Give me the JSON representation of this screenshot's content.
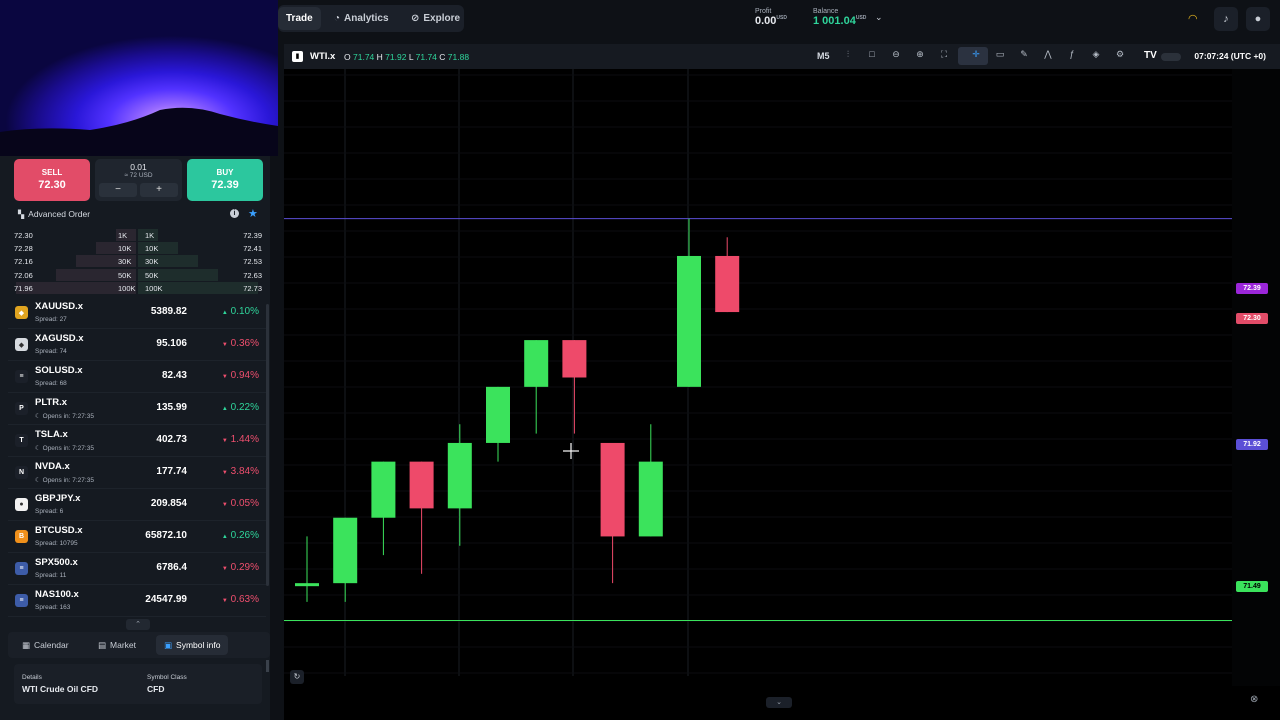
{
  "nav": {
    "trade": "Trade",
    "analytics": "Analytics",
    "explore": "Explore"
  },
  "account": {
    "profit_label": "Profit",
    "profit_value": "0.00",
    "profit_currency": "USD",
    "balance_label": "Balance",
    "balance_value": "1 001.04",
    "balance_currency": "USD"
  },
  "order": {
    "sell_label": "SELL",
    "sell_price": "72.30",
    "buy_label": "BUY",
    "buy_price": "72.39",
    "quantity": "0.01",
    "quantity_usd": "≈ 72 USD",
    "minus": "−",
    "plus": "+",
    "advanced_label": "Advanced Order"
  },
  "depth": [
    {
      "bid": "72.30",
      "bid_size": "1K",
      "ask_size": "1K",
      "ask": "72.39"
    },
    {
      "bid": "72.28",
      "bid_size": "10K",
      "ask_size": "10K",
      "ask": "72.41"
    },
    {
      "bid": "72.16",
      "bid_size": "30K",
      "ask_size": "30K",
      "ask": "72.53"
    },
    {
      "bid": "72.06",
      "bid_size": "50K",
      "ask_size": "50K",
      "ask": "72.63"
    },
    {
      "bid": "71.96",
      "bid_size": "100K",
      "ask_size": "100K",
      "ask": "72.73"
    }
  ],
  "watchlist": [
    {
      "name": "XAUUSD.x",
      "sub": "Spread: 27",
      "price": "5389.82",
      "change": "0.10%",
      "dir": "up",
      "icon": "gold-icon",
      "icon_char": "◆",
      "icon_bg": "#e0a420"
    },
    {
      "name": "XAGUSD.x",
      "sub": "Spread: 74",
      "price": "95.106",
      "change": "0.36%",
      "dir": "dn",
      "icon": "silver-icon",
      "icon_char": "◆",
      "icon_bg": "#d7dbe0"
    },
    {
      "name": "SOLUSD.x",
      "sub": "Spread: 68",
      "price": "82.43",
      "change": "0.94%",
      "dir": "dn",
      "icon": "solana-icon",
      "icon_char": "≡",
      "icon_bg": "#1b2029"
    },
    {
      "name": "PLTR.x",
      "sub": "Opens in: 7:27:35",
      "price": "135.99",
      "change": "0.22%",
      "dir": "up",
      "icon": "palantir-icon",
      "icon_char": "P",
      "icon_bg": "#1b2029"
    },
    {
      "name": "TSLA.x",
      "sub": "Opens in: 7:27:35",
      "price": "402.73",
      "change": "1.44%",
      "dir": "dn",
      "icon": "tesla-icon",
      "icon_char": "T",
      "icon_bg": "#1b2029"
    },
    {
      "name": "NVDA.x",
      "sub": "Opens in: 7:27:35",
      "price": "177.74",
      "change": "3.84%",
      "dir": "dn",
      "icon": "nvidia-icon",
      "icon_char": "N",
      "icon_bg": "#1b2029"
    },
    {
      "name": "GBPJPY.x",
      "sub": "Spread: 6",
      "price": "209.854",
      "change": "0.05%",
      "dir": "dn",
      "icon": "gbpjpy-flag-icon",
      "icon_char": "●",
      "icon_bg": "#f2f2f2"
    },
    {
      "name": "BTCUSD.x",
      "sub": "Spread: 10795",
      "price": "65872.10",
      "change": "0.26%",
      "dir": "up",
      "icon": "bitcoin-icon",
      "icon_char": "B",
      "icon_bg": "#f0901b"
    },
    {
      "name": "SPX500.x",
      "sub": "Spread: 11",
      "price": "6786.4",
      "change": "0.29%",
      "dir": "dn",
      "icon": "us-flag-icon",
      "icon_char": "≡",
      "icon_bg": "#3d5ca8"
    },
    {
      "name": "NAS100.x",
      "sub": "Spread: 163",
      "price": "24547.99",
      "change": "0.63%",
      "dir": "dn",
      "icon": "us-flag-icon",
      "icon_char": "≡",
      "icon_bg": "#3d5ca8"
    }
  ],
  "bottom_tabs": {
    "calendar": "Calendar",
    "market": "Market",
    "symbol_info": "Symbol info"
  },
  "symbol_info": {
    "details_label": "Details",
    "details_value": "WTI Crude Oil CFD",
    "class_label": "Symbol Class",
    "class_value": "CFD"
  },
  "chart_header": {
    "symbol": "WTI.x",
    "o_label": "O",
    "o": "71.74",
    "h_label": "H",
    "h": "71.92",
    "l_label": "L",
    "l": "71.74",
    "c_label": "C",
    "c": "71.88",
    "timeframe": "M5",
    "clock": "07:07:24 (UTC +0)"
  },
  "price_levels": {
    "buy": "72.39",
    "sell": "72.30",
    "mid": "71.92",
    "low": "71.49",
    "buy_color": "#9b26d9",
    "sell_color": "#e24c68",
    "mid_color": "#5b4fd6",
    "low_color": "#3be35c"
  },
  "chart_data": {
    "type": "candlestick",
    "candles": [
      {
        "o": 71.53,
        "h": 71.58,
        "l": 71.51,
        "c": 71.53
      },
      {
        "o": 71.53,
        "h": 71.6,
        "l": 71.51,
        "c": 71.6
      },
      {
        "o": 71.6,
        "h": 71.66,
        "l": 71.56,
        "c": 71.66
      },
      {
        "o": 71.66,
        "h": 71.66,
        "l": 71.54,
        "c": 71.61
      },
      {
        "o": 71.61,
        "h": 71.7,
        "l": 71.57,
        "c": 71.68
      },
      {
        "o": 71.68,
        "h": 71.74,
        "l": 71.66,
        "c": 71.74
      },
      {
        "o": 71.74,
        "h": 71.76,
        "l": 71.69,
        "c": 71.79
      },
      {
        "o": 71.79,
        "h": 71.79,
        "l": 71.69,
        "c": 71.75
      },
      {
        "o": 71.68,
        "h": 71.68,
        "l": 71.53,
        "c": 71.58
      },
      {
        "o": 71.58,
        "h": 71.7,
        "l": 71.58,
        "c": 71.66
      },
      {
        "o": 71.74,
        "h": 71.92,
        "l": 71.74,
        "c": 71.88
      },
      {
        "o": 71.88,
        "h": 71.9,
        "l": 71.84,
        "c": 71.82
      }
    ]
  }
}
